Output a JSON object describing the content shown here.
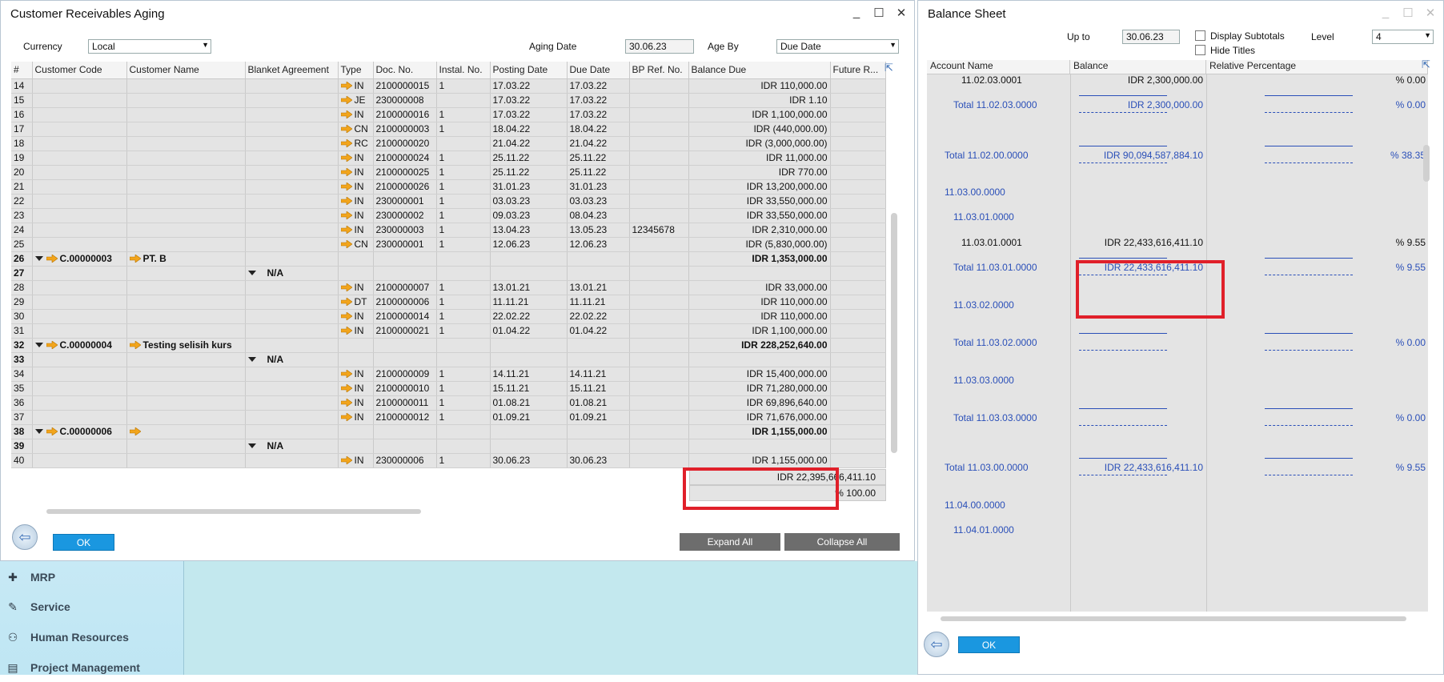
{
  "sidebar": {
    "items": [
      {
        "label": "MRP",
        "icon": "puzzle-icon"
      },
      {
        "label": "Service",
        "icon": "service-icon"
      },
      {
        "label": "Human Resources",
        "icon": "people-icon"
      },
      {
        "label": "Project Management",
        "icon": "project-icon"
      }
    ]
  },
  "aging": {
    "title": "Customer Receivables Aging",
    "currency_label": "Currency",
    "currency_value": "Local",
    "aging_date_label": "Aging Date",
    "aging_date_value": "30.06.23",
    "age_by_label": "Age By",
    "age_by_value": "Due Date",
    "columns": [
      "#",
      "Customer Code",
      "Customer Name",
      "Blanket Agreement",
      "Type",
      "Doc. No.",
      "Instal. No.",
      "Posting Date",
      "Due Date",
      "BP Ref. No.",
      "Balance Due",
      "Future R..."
    ],
    "rows": [
      {
        "n": "14",
        "code": "",
        "name": "",
        "blanket": "",
        "type": "IN",
        "doc": "2100000015",
        "inst": "1",
        "post": "17.03.22",
        "due": "17.03.22",
        "bp": "",
        "bal": "IDR  110,000.00"
      },
      {
        "n": "15",
        "code": "",
        "name": "",
        "blanket": "",
        "type": "JE",
        "doc": "230000008",
        "inst": "",
        "post": "17.03.22",
        "due": "17.03.22",
        "bp": "",
        "bal": "IDR  1.10"
      },
      {
        "n": "16",
        "code": "",
        "name": "",
        "blanket": "",
        "type": "IN",
        "doc": "2100000016",
        "inst": "1",
        "post": "17.03.22",
        "due": "17.03.22",
        "bp": "",
        "bal": "IDR  1,100,000.00"
      },
      {
        "n": "17",
        "code": "",
        "name": "",
        "blanket": "",
        "type": "CN",
        "doc": "2100000003",
        "inst": "1",
        "post": "18.04.22",
        "due": "18.04.22",
        "bp": "",
        "bal": "IDR  (440,000.00)"
      },
      {
        "n": "18",
        "code": "",
        "name": "",
        "blanket": "",
        "type": "RC",
        "doc": "2100000020",
        "inst": "",
        "post": "21.04.22",
        "due": "21.04.22",
        "bp": "",
        "bal": "IDR  (3,000,000.00)"
      },
      {
        "n": "19",
        "code": "",
        "name": "",
        "blanket": "",
        "type": "IN",
        "doc": "2100000024",
        "inst": "1",
        "post": "25.11.22",
        "due": "25.11.22",
        "bp": "",
        "bal": "IDR  11,000.00"
      },
      {
        "n": "20",
        "code": "",
        "name": "",
        "blanket": "",
        "type": "IN",
        "doc": "2100000025",
        "inst": "1",
        "post": "25.11.22",
        "due": "25.11.22",
        "bp": "",
        "bal": "IDR  770.00"
      },
      {
        "n": "21",
        "code": "",
        "name": "",
        "blanket": "",
        "type": "IN",
        "doc": "2100000026",
        "inst": "1",
        "post": "31.01.23",
        "due": "31.01.23",
        "bp": "",
        "bal": "IDR  13,200,000.00"
      },
      {
        "n": "22",
        "code": "",
        "name": "",
        "blanket": "",
        "type": "IN",
        "doc": "230000001",
        "inst": "1",
        "post": "03.03.23",
        "due": "03.03.23",
        "bp": "",
        "bal": "IDR  33,550,000.00"
      },
      {
        "n": "23",
        "code": "",
        "name": "",
        "blanket": "",
        "type": "IN",
        "doc": "230000002",
        "inst": "1",
        "post": "09.03.23",
        "due": "08.04.23",
        "bp": "",
        "bal": "IDR  33,550,000.00"
      },
      {
        "n": "24",
        "code": "",
        "name": "",
        "blanket": "",
        "type": "IN",
        "doc": "230000003",
        "inst": "1",
        "post": "13.04.23",
        "due": "13.05.23",
        "bp": "12345678",
        "bal": "IDR  2,310,000.00"
      },
      {
        "n": "25",
        "code": "",
        "name": "",
        "blanket": "",
        "type": "CN",
        "doc": "230000001",
        "inst": "1",
        "post": "12.06.23",
        "due": "12.06.23",
        "bp": "",
        "bal": "IDR  (5,830,000.00)"
      },
      {
        "n": "26",
        "group": "customer",
        "code": "C.00000003",
        "name": "PT. B",
        "blanket": "",
        "type": "",
        "doc": "",
        "inst": "",
        "post": "",
        "due": "",
        "bp": "",
        "bal": "IDR  1,353,000.00"
      },
      {
        "n": "27",
        "group": "blanket",
        "code": "",
        "name": "",
        "blanket": "N/A",
        "type": "",
        "doc": "",
        "inst": "",
        "post": "",
        "due": "",
        "bp": "",
        "bal": ""
      },
      {
        "n": "28",
        "code": "",
        "name": "",
        "blanket": "",
        "type": "IN",
        "doc": "2100000007",
        "inst": "1",
        "post": "13.01.21",
        "due": "13.01.21",
        "bp": "",
        "bal": "IDR  33,000.00"
      },
      {
        "n": "29",
        "code": "",
        "name": "",
        "blanket": "",
        "type": "DT",
        "doc": "2100000006",
        "inst": "1",
        "post": "11.11.21",
        "due": "11.11.21",
        "bp": "",
        "bal": "IDR  110,000.00"
      },
      {
        "n": "30",
        "code": "",
        "name": "",
        "blanket": "",
        "type": "IN",
        "doc": "2100000014",
        "inst": "1",
        "post": "22.02.22",
        "due": "22.02.22",
        "bp": "",
        "bal": "IDR  110,000.00"
      },
      {
        "n": "31",
        "code": "",
        "name": "",
        "blanket": "",
        "type": "IN",
        "doc": "2100000021",
        "inst": "1",
        "post": "01.04.22",
        "due": "01.04.22",
        "bp": "",
        "bal": "IDR  1,100,000.00"
      },
      {
        "n": "32",
        "group": "customer",
        "code": "C.00000004",
        "name": "Testing selisih kurs",
        "blanket": "",
        "type": "",
        "doc": "",
        "inst": "",
        "post": "",
        "due": "",
        "bp": "",
        "bal": "IDR  228,252,640.00"
      },
      {
        "n": "33",
        "group": "blanket",
        "code": "",
        "name": "",
        "blanket": "N/A",
        "type": "",
        "doc": "",
        "inst": "",
        "post": "",
        "due": "",
        "bp": "",
        "bal": ""
      },
      {
        "n": "34",
        "code": "",
        "name": "",
        "blanket": "",
        "type": "IN",
        "doc": "2100000009",
        "inst": "1",
        "post": "14.11.21",
        "due": "14.11.21",
        "bp": "",
        "bal": "IDR  15,400,000.00"
      },
      {
        "n": "35",
        "code": "",
        "name": "",
        "blanket": "",
        "type": "IN",
        "doc": "2100000010",
        "inst": "1",
        "post": "15.11.21",
        "due": "15.11.21",
        "bp": "",
        "bal": "IDR  71,280,000.00"
      },
      {
        "n": "36",
        "code": "",
        "name": "",
        "blanket": "",
        "type": "IN",
        "doc": "2100000011",
        "inst": "1",
        "post": "01.08.21",
        "due": "01.08.21",
        "bp": "",
        "bal": "IDR  69,896,640.00"
      },
      {
        "n": "37",
        "code": "",
        "name": "",
        "blanket": "",
        "type": "IN",
        "doc": "2100000012",
        "inst": "1",
        "post": "01.09.21",
        "due": "01.09.21",
        "bp": "",
        "bal": "IDR  71,676,000.00"
      },
      {
        "n": "38",
        "group": "customer",
        "code": "C.00000006",
        "name": "",
        "blanket": "",
        "type": "",
        "doc": "",
        "inst": "",
        "post": "",
        "due": "",
        "bp": "",
        "bal": "IDR  1,155,000.00"
      },
      {
        "n": "39",
        "group": "blanket",
        "code": "",
        "name": "",
        "blanket": "N/A",
        "type": "",
        "doc": "",
        "inst": "",
        "post": "",
        "due": "",
        "bp": "",
        "bal": ""
      },
      {
        "n": "40",
        "code": "",
        "name": "",
        "blanket": "",
        "type": "IN",
        "doc": "230000006",
        "inst": "1",
        "post": "30.06.23",
        "due": "30.06.23",
        "bp": "",
        "bal": "IDR  1,155,000.00"
      }
    ],
    "total_balance": "IDR  22,395,666,411.10",
    "total_percent": "% 100.00",
    "ok_label": "OK",
    "expand_label": "Expand All",
    "collapse_label": "Collapse All"
  },
  "balance_sheet": {
    "title": "Balance Sheet",
    "up_to_label": "Up to",
    "up_to_value": "30.06.23",
    "display_subtotals_label": "Display Subtotals",
    "hide_titles_label": "Hide Titles",
    "level_label": "Level",
    "level_value": "4",
    "columns": [
      "Account Name",
      "Balance",
      "Relative Percentage"
    ],
    "rows": [
      {
        "name": "11.02.03.0001",
        "indent": "deep",
        "blue": false,
        "balance": "IDR  2,300,000.00",
        "pct": "% 0.00"
      },
      {
        "name": "Total 11.02.03.0000",
        "indent": "mid",
        "blue": true,
        "balance": "IDR  2,300,000.00",
        "pct": "% 0.00"
      },
      {
        "name": "Total 11.02.00.0000",
        "indent": "low",
        "blue": true,
        "balance": "IDR  90,094,587,884.10",
        "pct": "% 38.35"
      },
      {
        "name": "11.03.00.0000",
        "indent": "top",
        "blue": true,
        "balance": "",
        "pct": ""
      },
      {
        "name": "11.03.01.0000",
        "indent": "mid",
        "blue": true,
        "balance": "",
        "pct": ""
      },
      {
        "name": "11.03.01.0001",
        "indent": "deep",
        "blue": false,
        "balance": "IDR  22,433,616,411.10",
        "pct": "% 9.55"
      },
      {
        "name": "Total 11.03.01.0000",
        "indent": "mid",
        "blue": true,
        "balance": "IDR  22,433,616,411.10",
        "pct": "% 9.55"
      },
      {
        "name": "11.03.02.0000",
        "indent": "mid",
        "blue": true,
        "balance": "",
        "pct": ""
      },
      {
        "name": "Total 11.03.02.0000",
        "indent": "mid",
        "blue": true,
        "balance": "",
        "pct": "% 0.00"
      },
      {
        "name": "11.03.03.0000",
        "indent": "mid",
        "blue": true,
        "balance": "",
        "pct": ""
      },
      {
        "name": "Total 11.03.03.0000",
        "indent": "mid",
        "blue": true,
        "balance": "",
        "pct": "% 0.00"
      },
      {
        "name": "Total 11.03.00.0000",
        "indent": "low",
        "blue": true,
        "balance": "IDR  22,433,616,411.10",
        "pct": "% 9.55"
      },
      {
        "name": "11.04.00.0000",
        "indent": "top",
        "blue": true,
        "balance": "",
        "pct": ""
      },
      {
        "name": "11.04.01.0000",
        "indent": "mid",
        "blue": true,
        "balance": "",
        "pct": ""
      }
    ],
    "ok_label": "OK"
  },
  "colors": {
    "accent": "#1a97e0",
    "highlight": "#e0202a",
    "link_blue": "#2a4fb8",
    "arrow_orange": "#f2a51c"
  }
}
